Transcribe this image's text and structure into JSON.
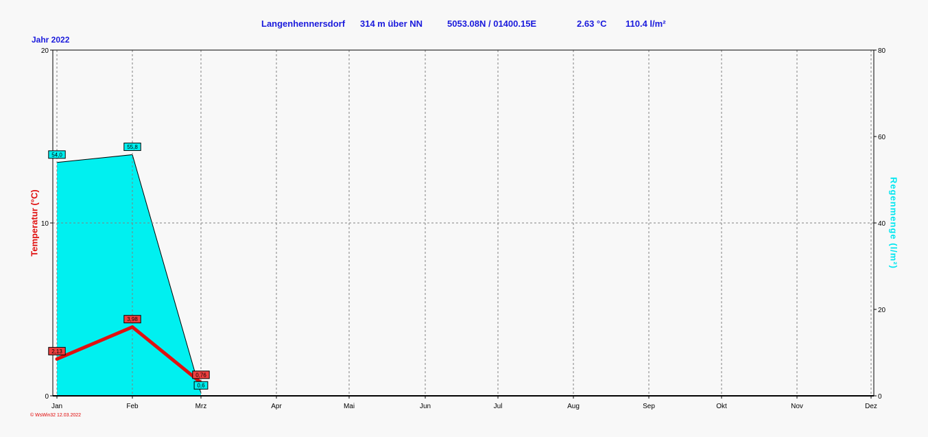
{
  "header": {
    "station": "Langenhennersdorf",
    "altitude": "314 m über NN",
    "coords": "5053.08N / 01400.15E",
    "temp": "2.63 °C",
    "rain": "110.4 l/m²"
  },
  "year_label": "Jahr  2022",
  "footer": "© WsWin32  12.03.2022",
  "colors": {
    "temperature": "#e01010",
    "rain": "#00f0f0",
    "text": "#1a1adc"
  },
  "chart_data": {
    "type": "line+area",
    "categories": [
      "Jan",
      "Feb",
      "Mrz",
      "Apr",
      "Mai",
      "Jun",
      "Jul",
      "Aug",
      "Sep",
      "Okt",
      "Nov",
      "Dez"
    ],
    "left_axis": {
      "label": "Temperatur  (°C)",
      "ylim": [
        0,
        20
      ],
      "ticks": [
        0,
        10,
        20
      ]
    },
    "right_axis": {
      "label": "Regenmenge  (l/m²)",
      "ylim": [
        0,
        80
      ],
      "ticks": [
        0,
        20,
        40,
        60,
        80
      ]
    },
    "series": [
      {
        "name": "Regenmenge",
        "type": "area",
        "axis": "right",
        "values": [
          54.0,
          55.8,
          0.6
        ],
        "labels": [
          "54,0",
          "55,8",
          "0,6"
        ]
      },
      {
        "name": "Temperatur",
        "type": "line",
        "axis": "left",
        "values": [
          2.13,
          3.98,
          0.76
        ],
        "labels": [
          "2,13",
          "3,98",
          "0,76"
        ]
      }
    ],
    "grid": true
  }
}
